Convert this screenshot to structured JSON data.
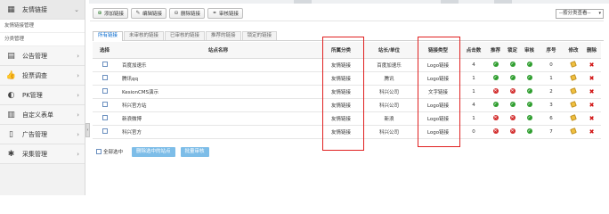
{
  "sidebar": {
    "groups": [
      {
        "label": "友情链接",
        "icon": "grid-icon",
        "sub": [
          "友情链接管理",
          "分类管理"
        ]
      },
      {
        "label": "公告管理",
        "icon": "calendar-icon"
      },
      {
        "label": "投票调查",
        "icon": "thumbs-up-icon"
      },
      {
        "label": "PK管理",
        "icon": "half-circle-icon"
      },
      {
        "label": "自定义表单",
        "icon": "table-icon"
      },
      {
        "label": "广告管理",
        "icon": "columns-icon"
      },
      {
        "label": "采集管理",
        "icon": "cog-star-icon"
      }
    ]
  },
  "toolbar": {
    "add_label": "添加链接",
    "edit_label": "编辑链接",
    "delete_label": "删除链接",
    "audit_label": "审核链接",
    "category_select": "--按分类查看--"
  },
  "tabs": [
    "所有链接",
    "未审核的链接",
    "已审核的链接",
    "推荐的链接",
    "锁定的链接"
  ],
  "table": {
    "headers": [
      "选择",
      "站点名称",
      "所属分类",
      "站长/单位",
      "链接类型",
      "点击数",
      "推荐",
      "锁定",
      "审核",
      "序号",
      "修改",
      "删除"
    ],
    "rows": [
      {
        "name": "百度加速乐",
        "category": "友情链接",
        "owner": "百度加速乐",
        "type": "Logo链接",
        "clicks": "4",
        "recommend": "ok",
        "lock": "ok",
        "audit": "ok",
        "order": "0"
      },
      {
        "name": "腾讯qq",
        "category": "友情链接",
        "owner": "腾讯",
        "type": "Logo链接",
        "clicks": "1",
        "recommend": "ok",
        "lock": "ok",
        "audit": "ok",
        "order": "1"
      },
      {
        "name": "KesionCMS演示",
        "category": "友情链接",
        "owner": "科兴公司",
        "type": "文字链接",
        "clicks": "1",
        "recommend": "no",
        "lock": "no",
        "audit": "ok",
        "order": "2"
      },
      {
        "name": "科兴官方站",
        "category": "友情链接",
        "owner": "科兴公司",
        "type": "Logo链接",
        "clicks": "4",
        "recommend": "ok",
        "lock": "ok",
        "audit": "ok",
        "order": "3"
      },
      {
        "name": "新浪微博",
        "category": "友情链接",
        "owner": "新浪",
        "type": "Logo链接",
        "clicks": "1",
        "recommend": "no",
        "lock": "no",
        "audit": "ok",
        "order": "6"
      },
      {
        "name": "科兴官方",
        "category": "友情链接",
        "owner": "科兴公司",
        "type": "Logo链接",
        "clicks": "0",
        "recommend": "no",
        "lock": "no",
        "audit": "ok",
        "order": "7"
      }
    ]
  },
  "bottom": {
    "select_all": "全部选中",
    "delete_selected": "删除选中的站点",
    "batch_audit": "批量审核"
  },
  "colors": {
    "highlight": "#e02020",
    "ok": "#2f9e2f",
    "no": "#d32f2f",
    "tab_active": "#0066cc"
  }
}
